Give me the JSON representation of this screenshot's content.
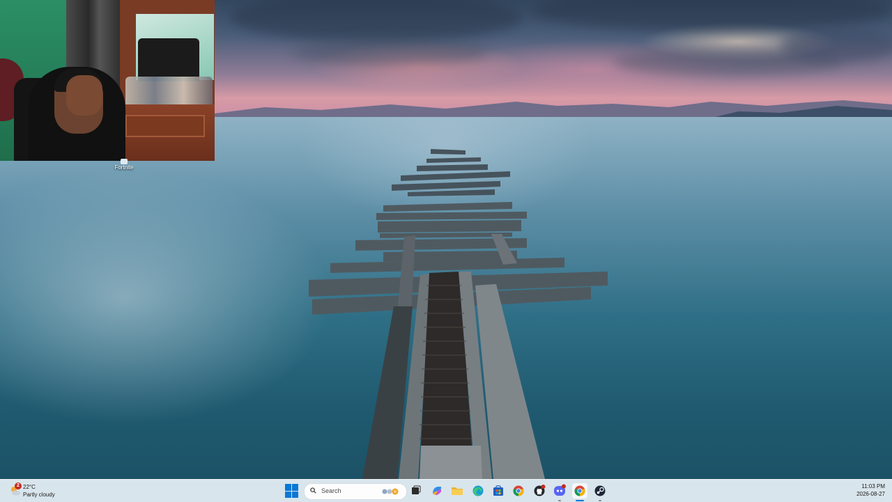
{
  "desktop": {
    "icons": [
      {
        "label": "Fortnite"
      }
    ]
  },
  "taskbar": {
    "weather": {
      "badge": "2",
      "temperature": "22°C",
      "condition": "Partly cloudy"
    },
    "search": {
      "placeholder": "Search"
    },
    "apps": [
      {
        "name": "Task View",
        "icon": "task-view-icon"
      },
      {
        "name": "Copilot",
        "icon": "copilot-icon"
      },
      {
        "name": "File Explorer",
        "icon": "folder-icon"
      },
      {
        "name": "Microsoft Edge",
        "icon": "edge-icon"
      },
      {
        "name": "Microsoft Store",
        "icon": "store-icon"
      },
      {
        "name": "Google Chrome",
        "icon": "chrome-icon"
      },
      {
        "name": "GitHub Desktop",
        "icon": "github-icon"
      },
      {
        "name": "Discord",
        "icon": "discord-icon"
      },
      {
        "name": "Google Chrome (active)",
        "icon": "chrome-icon"
      },
      {
        "name": "Steam",
        "icon": "steam-icon"
      }
    ],
    "clock": {
      "time": "11:03 PM",
      "date": "2026-08-27"
    }
  },
  "colors": {
    "accent": "#0a78d4",
    "taskbar_bg": "#e4eef4",
    "notification_red": "#c42b1c"
  }
}
